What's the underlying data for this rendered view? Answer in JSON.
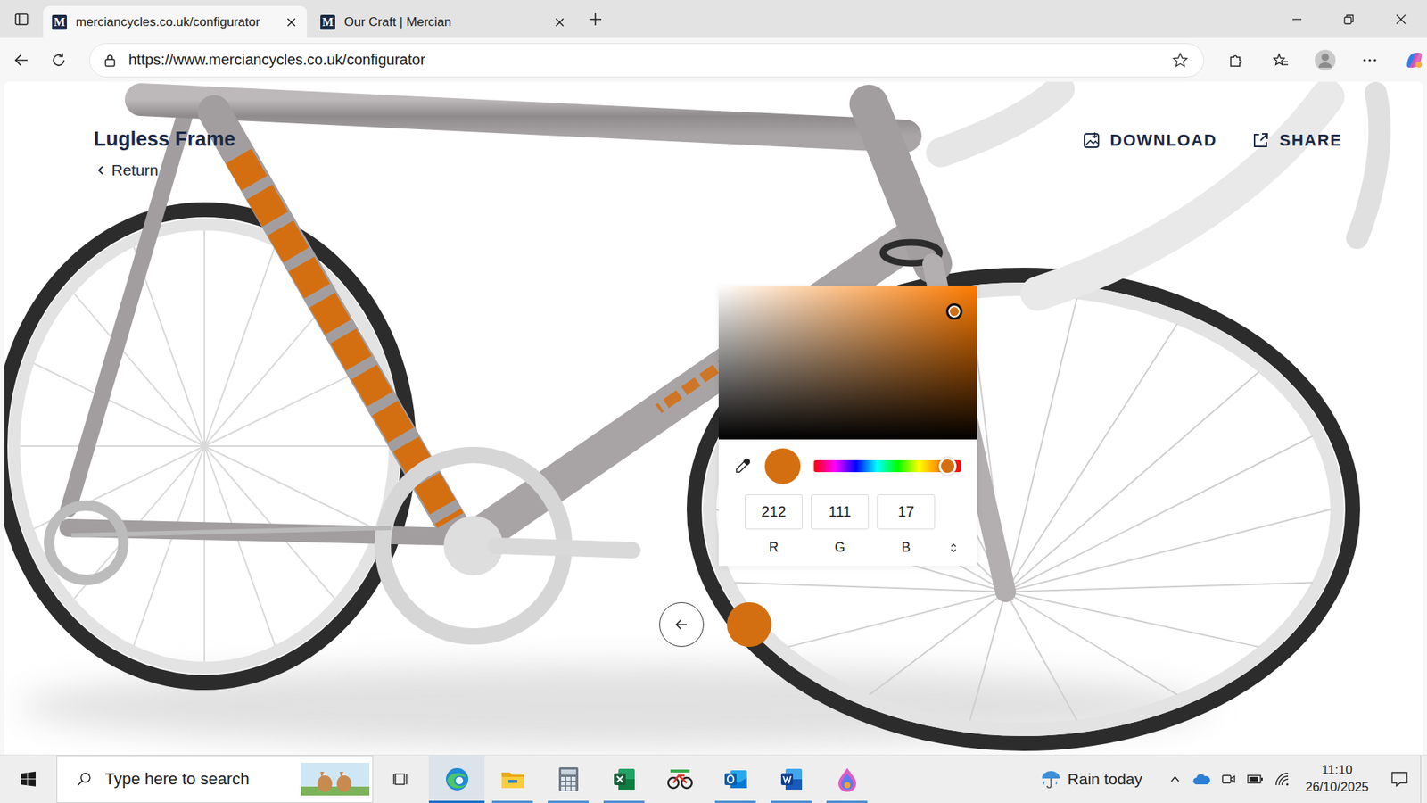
{
  "tabs": [
    {
      "icon_letter": "M",
      "label": "merciancycles.co.uk/configurator",
      "selected": true
    },
    {
      "icon_letter": "M",
      "label": "Our Craft | Mercian",
      "selected": false
    }
  ],
  "address_bar": {
    "url": "https://www.merciancycles.co.uk/configurator"
  },
  "page": {
    "title": "Lugless Frame",
    "return": "Return",
    "actions": [
      {
        "label": "DOWNLOAD",
        "kind": "download"
      },
      {
        "label": "SHARE",
        "kind": "share"
      }
    ]
  },
  "color_picker": {
    "color": "#d46f11",
    "saturation": 0.91,
    "brightness": 0.83,
    "hue_level": 0.91,
    "channels": [
      {
        "label": "R",
        "value": "212"
      },
      {
        "label": "G",
        "value": "111"
      },
      {
        "label": "B",
        "value": "17"
      }
    ]
  },
  "taskbar": {
    "search_placeholder": "Type here to search",
    "apps": [
      {
        "kind": "edge",
        "running": true,
        "active": true
      },
      {
        "kind": "explorer",
        "running": true,
        "active": false
      },
      {
        "kind": "calculator",
        "running": true,
        "active": false
      },
      {
        "kind": "excel",
        "running": true,
        "active": false
      },
      {
        "kind": "cycling",
        "running": false,
        "active": false
      },
      {
        "kind": "outlook",
        "running": true,
        "active": false
      },
      {
        "kind": "word",
        "running": true,
        "active": false
      },
      {
        "kind": "paint",
        "running": true,
        "active": false
      }
    ],
    "weather": "Rain today",
    "time": "11:10",
    "date": "26/10/2025"
  }
}
